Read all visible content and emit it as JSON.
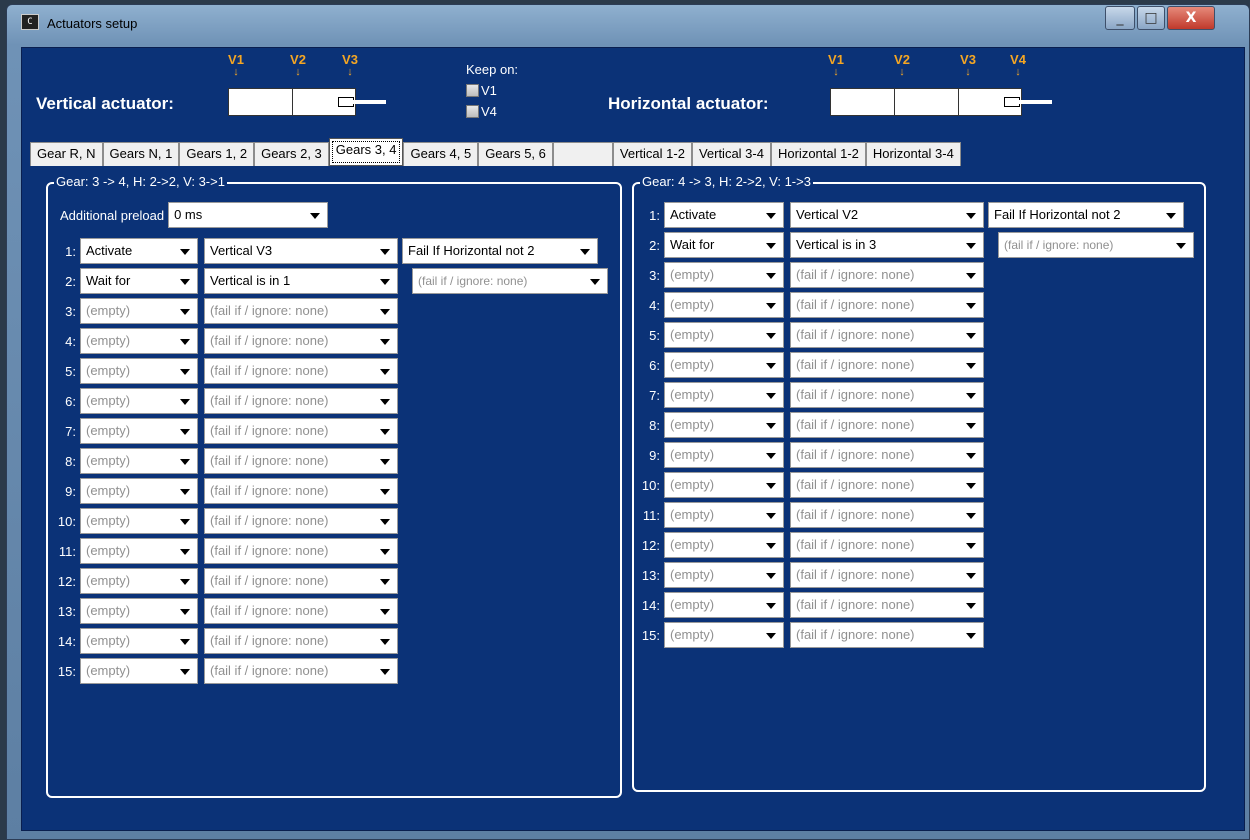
{
  "window": {
    "title": "Actuators setup",
    "app_icon_text": "C",
    "minimize_glyph": "_",
    "maximize_glyph": "□",
    "close_glyph": "X"
  },
  "top": {
    "vertical_label": "Vertical actuator:",
    "horizontal_label": "Horizontal actuator:",
    "vertical_markers": [
      "V1",
      "V2",
      "V3"
    ],
    "horizontal_markers": [
      "V1",
      "V2",
      "V3",
      "V4"
    ],
    "keep_on_label": "Keep on:",
    "keep_on_options": [
      "V1",
      "V4"
    ]
  },
  "tabs": [
    "Gear R, N",
    "Gears N, 1",
    "Gears 1, 2",
    "Gears 2, 3",
    "Gears 3, 4",
    "Gears 4, 5",
    "Gears 5, 6",
    "",
    "Vertical 1-2",
    "Vertical 3-4",
    "Horizontal 1-2",
    "Horizontal 3-4"
  ],
  "active_tab": "Gears 3, 4",
  "left_panel": {
    "title": "Gear: 3 -> 4, H: 2->2, V: 3->1",
    "preload_label": "Additional preload",
    "preload_value": "0 ms",
    "rows": [
      {
        "num": "1:",
        "action": "Activate",
        "target": "Vertical V3",
        "fail": "Fail If Horizontal not 2"
      },
      {
        "num": "2:",
        "action": "Wait for",
        "target": "Vertical is in 1",
        "fail": "(fail if / ignore: none)"
      },
      {
        "num": "3:",
        "action": "(empty)",
        "target": "(fail if / ignore: none)"
      },
      {
        "num": "4:",
        "action": "(empty)",
        "target": "(fail if / ignore: none)"
      },
      {
        "num": "5:",
        "action": "(empty)",
        "target": "(fail if / ignore: none)"
      },
      {
        "num": "6:",
        "action": "(empty)",
        "target": "(fail if / ignore: none)"
      },
      {
        "num": "7:",
        "action": "(empty)",
        "target": "(fail if / ignore: none)"
      },
      {
        "num": "8:",
        "action": "(empty)",
        "target": "(fail if / ignore: none)"
      },
      {
        "num": "9:",
        "action": "(empty)",
        "target": "(fail if / ignore: none)"
      },
      {
        "num": "10:",
        "action": "(empty)",
        "target": "(fail if / ignore: none)"
      },
      {
        "num": "11:",
        "action": "(empty)",
        "target": "(fail if / ignore: none)"
      },
      {
        "num": "12:",
        "action": "(empty)",
        "target": "(fail if / ignore: none)"
      },
      {
        "num": "13:",
        "action": "(empty)",
        "target": "(fail if / ignore: none)"
      },
      {
        "num": "14:",
        "action": "(empty)",
        "target": "(fail if / ignore: none)"
      },
      {
        "num": "15:",
        "action": "(empty)",
        "target": "(fail if / ignore: none)"
      }
    ]
  },
  "right_panel": {
    "title": "Gear: 4 -> 3, H: 2->2, V: 1->3",
    "rows": [
      {
        "num": "1:",
        "action": "Activate",
        "target": "Vertical V2",
        "fail": "Fail If Horizontal not 2"
      },
      {
        "num": "2:",
        "action": "Wait for",
        "target": "Vertical is in 3",
        "fail": "(fail if / ignore: none)"
      },
      {
        "num": "3:",
        "action": "(empty)",
        "target": "(fail if / ignore: none)"
      },
      {
        "num": "4:",
        "action": "(empty)",
        "target": "(fail if / ignore: none)"
      },
      {
        "num": "5:",
        "action": "(empty)",
        "target": "(fail if / ignore: none)"
      },
      {
        "num": "6:",
        "action": "(empty)",
        "target": "(fail if / ignore: none)"
      },
      {
        "num": "7:",
        "action": "(empty)",
        "target": "(fail if / ignore: none)"
      },
      {
        "num": "8:",
        "action": "(empty)",
        "target": "(fail if / ignore: none)"
      },
      {
        "num": "9:",
        "action": "(empty)",
        "target": "(fail if / ignore: none)"
      },
      {
        "num": "10:",
        "action": "(empty)",
        "target": "(fail if / ignore: none)"
      },
      {
        "num": "11:",
        "action": "(empty)",
        "target": "(fail if / ignore: none)"
      },
      {
        "num": "12:",
        "action": "(empty)",
        "target": "(fail if / ignore: none)"
      },
      {
        "num": "13:",
        "action": "(empty)",
        "target": "(fail if / ignore: none)"
      },
      {
        "num": "14:",
        "action": "(empty)",
        "target": "(fail if / ignore: none)"
      },
      {
        "num": "15:",
        "action": "(empty)",
        "target": "(fail if / ignore: none)"
      }
    ]
  },
  "colors": {
    "background": "#0b3277",
    "marker": "#f5a623",
    "placeholder_text": "#909090"
  }
}
